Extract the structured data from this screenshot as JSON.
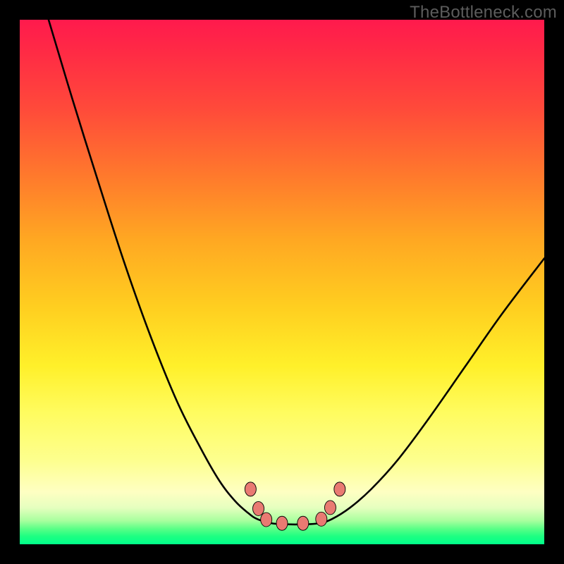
{
  "watermark": "TheBottleneck.com",
  "chart_data": {
    "type": "line",
    "title": "",
    "xlabel": "",
    "ylabel": "",
    "xlim": [
      0,
      1
    ],
    "ylim": [
      0,
      1
    ],
    "note": "Axes unlabeled; values are normalized plot coordinates (x from left, y from top).",
    "series": [
      {
        "name": "left-branch",
        "x": [
          0.055,
          0.1,
          0.15,
          0.2,
          0.25,
          0.3,
          0.345,
          0.38,
          0.41,
          0.435,
          0.453
        ],
        "y": [
          0.0,
          0.15,
          0.31,
          0.465,
          0.605,
          0.728,
          0.817,
          0.878,
          0.917,
          0.94,
          0.952
        ]
      },
      {
        "name": "valley",
        "x": [
          0.453,
          0.48,
          0.51,
          0.54,
          0.57,
          0.595
        ],
        "y": [
          0.952,
          0.96,
          0.962,
          0.962,
          0.96,
          0.952
        ]
      },
      {
        "name": "right-branch",
        "x": [
          0.595,
          0.63,
          0.67,
          0.72,
          0.78,
          0.85,
          0.92,
          1.0
        ],
        "y": [
          0.952,
          0.93,
          0.895,
          0.84,
          0.76,
          0.66,
          0.56,
          0.455
        ]
      }
    ],
    "markers": {
      "name": "hotspot-markers",
      "points": [
        {
          "x": 0.44,
          "y": 0.895
        },
        {
          "x": 0.455,
          "y": 0.932
        },
        {
          "x": 0.47,
          "y": 0.953
        },
        {
          "x": 0.5,
          "y": 0.96
        },
        {
          "x": 0.54,
          "y": 0.96
        },
        {
          "x": 0.575,
          "y": 0.952
        },
        {
          "x": 0.592,
          "y": 0.93
        },
        {
          "x": 0.61,
          "y": 0.895
        }
      ]
    },
    "background_gradient_stops": [
      {
        "pos": 0.0,
        "color": "#ff1a4d"
      },
      {
        "pos": 0.3,
        "color": "#ff7a2c"
      },
      {
        "pos": 0.66,
        "color": "#fff02a"
      },
      {
        "pos": 0.9,
        "color": "#feffc2"
      },
      {
        "pos": 1.0,
        "color": "#00ff8a"
      }
    ]
  }
}
